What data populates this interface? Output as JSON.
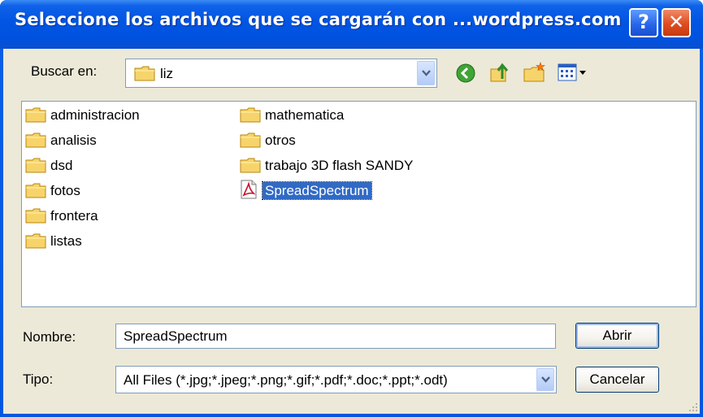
{
  "window": {
    "title": "Seleccione los archivos que se cargarán con ...wordpress.com",
    "help_glyph": "?",
    "close_glyph": "✕"
  },
  "lookin": {
    "label": "Buscar en:",
    "value": "liz"
  },
  "toolbar": {
    "icons": [
      "back-icon",
      "up-folder-icon",
      "new-folder-icon",
      "view-menu-icon"
    ]
  },
  "files": {
    "column1": [
      "administracion",
      "analisis",
      "dsd",
      "fotos",
      "frontera",
      "listas"
    ],
    "column2": [
      "mathematica",
      "otros",
      "trabajo 3D flash SANDY"
    ],
    "selected_file": "SpreadSpectrum"
  },
  "filename": {
    "label": "Nombre:",
    "value": "SpreadSpectrum"
  },
  "filetype": {
    "label": "Tipo:",
    "value": "All Files (*.jpg;*.jpeg;*.png;*.gif;*.pdf;*.doc;*.ppt;*.odt)"
  },
  "buttons": {
    "open": "Abrir",
    "cancel": "Cancelar"
  },
  "colors": {
    "titlebar": "#0055e3",
    "selection": "#316ac5",
    "dialog_bg": "#ece9d8",
    "folder_yellow": "#f7d46b"
  }
}
